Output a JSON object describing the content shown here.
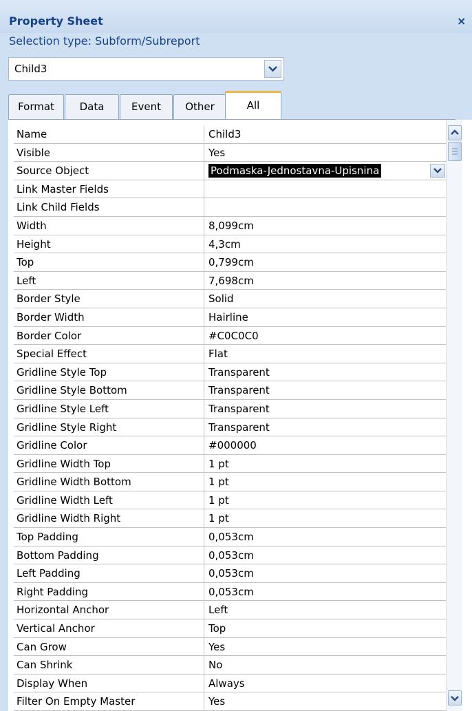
{
  "panel": {
    "title": "Property Sheet",
    "close_glyph": "×",
    "selection_type": "Selection type:  Subform/Subreport"
  },
  "object_selector": {
    "value": "Child3"
  },
  "tabs": [
    {
      "label": "Format",
      "active": false
    },
    {
      "label": "Data",
      "active": false
    },
    {
      "label": "Event",
      "active": false
    },
    {
      "label": "Other",
      "active": false
    },
    {
      "label": "All",
      "active": true
    }
  ],
  "properties": [
    {
      "name": "Name",
      "value": "Child3"
    },
    {
      "name": "Visible",
      "value": "Yes"
    },
    {
      "name": "Source Object",
      "value": "Podmaska-Jednostavna-Upisnina",
      "selected": true
    },
    {
      "name": "Link Master Fields",
      "value": ""
    },
    {
      "name": "Link Child Fields",
      "value": ""
    },
    {
      "name": "Width",
      "value": "8,099cm"
    },
    {
      "name": "Height",
      "value": "4,3cm"
    },
    {
      "name": "Top",
      "value": "0,799cm"
    },
    {
      "name": "Left",
      "value": "7,698cm"
    },
    {
      "name": "Border Style",
      "value": "Solid"
    },
    {
      "name": "Border Width",
      "value": "Hairline"
    },
    {
      "name": "Border Color",
      "value": "#C0C0C0"
    },
    {
      "name": "Special Effect",
      "value": "Flat"
    },
    {
      "name": "Gridline Style Top",
      "value": "Transparent"
    },
    {
      "name": "Gridline Style Bottom",
      "value": "Transparent"
    },
    {
      "name": "Gridline Style Left",
      "value": "Transparent"
    },
    {
      "name": "Gridline Style Right",
      "value": "Transparent"
    },
    {
      "name": "Gridline Color",
      "value": "#000000"
    },
    {
      "name": "Gridline Width Top",
      "value": "1 pt"
    },
    {
      "name": "Gridline Width Bottom",
      "value": "1 pt"
    },
    {
      "name": "Gridline Width Left",
      "value": "1 pt"
    },
    {
      "name": "Gridline Width Right",
      "value": "1 pt"
    },
    {
      "name": "Top Padding",
      "value": "0,053cm"
    },
    {
      "name": "Bottom Padding",
      "value": "0,053cm"
    },
    {
      "name": "Left Padding",
      "value": "0,053cm"
    },
    {
      "name": "Right Padding",
      "value": "0,053cm"
    },
    {
      "name": "Horizontal Anchor",
      "value": "Left"
    },
    {
      "name": "Vertical Anchor",
      "value": "Top"
    },
    {
      "name": "Can Grow",
      "value": "Yes"
    },
    {
      "name": "Can Shrink",
      "value": "No"
    },
    {
      "name": "Display When",
      "value": "Always"
    },
    {
      "name": "Filter On Empty Master",
      "value": "Yes"
    }
  ],
  "colors": {
    "title_text": "#15428b",
    "panel_bg": "#cfe0f3",
    "active_tab_accent": "#f3b548",
    "grid_line": "#c0c0c0"
  },
  "icons": {
    "close": "close-icon",
    "dropdown": "chevron-down-icon",
    "scroll_up": "arrow-up-icon",
    "scroll_down": "arrow-down-icon"
  }
}
